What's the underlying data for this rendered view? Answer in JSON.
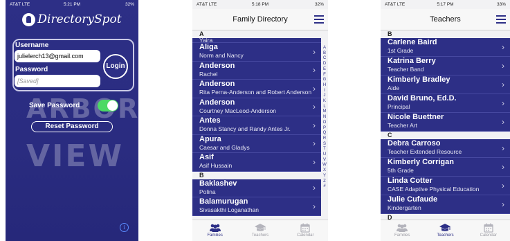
{
  "colors": {
    "brand": "#2d2f86",
    "toggle_on": "#4cd964",
    "info": "#5a8cff"
  },
  "login_screen": {
    "status": {
      "carrier": "AT&T LTE",
      "time": "5:21 PM",
      "battery": "32%"
    },
    "app_name": "DirectorySpot",
    "username_label": "Username",
    "username_value": "julielerch13@gmail.com",
    "password_label": "Password",
    "password_placeholder": "[Saved]",
    "login_button": "Login",
    "save_password_label": "Save Password",
    "reset_password_button": "Reset Password",
    "watermark_top": "ARBOR",
    "watermark_bottom": "VIEW"
  },
  "family_directory": {
    "status": {
      "carrier": "AT&T LTE",
      "time": "5:18 PM",
      "battery": "32%"
    },
    "title": "Family Directory",
    "sections": [
      {
        "letter": "A",
        "rows": [
          {
            "name": "Aliga",
            "sub": "Norm and Nancy"
          },
          {
            "name": "Anderson",
            "sub": "Rachel"
          },
          {
            "name": "Anderson",
            "sub": "Rita Perna-Anderson and Robert Anderson"
          },
          {
            "name": "Anderson",
            "sub": "Courtney MacLeod-Anderson"
          },
          {
            "name": "Antes",
            "sub": "Donna Stancy and Randy Antes Jr."
          },
          {
            "name": "Apura",
            "sub": "Caesar and Gladys"
          },
          {
            "name": "Asif",
            "sub": "Asif Hussain"
          }
        ]
      },
      {
        "letter": "B",
        "rows": [
          {
            "name": "Baklashev",
            "sub": "Polina"
          },
          {
            "name": "Balamurugan",
            "sub": "Sivasakthi Loganathan"
          }
        ]
      }
    ],
    "partial_top_text": "Yaira",
    "index_letters": [
      "A",
      "B",
      "C",
      "D",
      "E",
      "F",
      "G",
      "H",
      "I",
      "J",
      "K",
      "L",
      "M",
      "N",
      "O",
      "P",
      "Q",
      "R",
      "S",
      "T",
      "U",
      "V",
      "W",
      "X",
      "Y",
      "Z",
      "#"
    ],
    "tabs": [
      {
        "label": "Families",
        "icon": "people-icon",
        "active": true
      },
      {
        "label": "Teachers",
        "icon": "graduation-cap-icon",
        "active": false
      },
      {
        "label": "Calendar",
        "icon": "calendar-icon",
        "active": false
      }
    ]
  },
  "teachers": {
    "status": {
      "carrier": "AT&T LTE",
      "time": "5:17 PM",
      "battery": "33%"
    },
    "title": "Teachers",
    "sections": [
      {
        "letter": "B",
        "rows": [
          {
            "name": "Carlene Baird",
            "sub": "1st Grade"
          },
          {
            "name": "Katrina Berry",
            "sub": "Teacher Band"
          },
          {
            "name": "Kimberly Bradley",
            "sub": "Aide"
          },
          {
            "name": "David Bruno, Ed.D.",
            "sub": "Principal"
          },
          {
            "name": "Nicole Buettner",
            "sub": "Teacher Art"
          }
        ]
      },
      {
        "letter": "C",
        "rows": [
          {
            "name": "Debra Carroso",
            "sub": "Teacher Extended Resource"
          },
          {
            "name": "Kimberly Corrigan",
            "sub": "5th Grade"
          },
          {
            "name": "Linda Cotter",
            "sub": "CASE Adaptive Physical Education"
          },
          {
            "name": "Julie Cufaude",
            "sub": "Kindergarten"
          }
        ]
      },
      {
        "letter": "D",
        "rows": []
      }
    ],
    "tabs": [
      {
        "label": "Families",
        "icon": "people-icon",
        "active": false
      },
      {
        "label": "Teachers",
        "icon": "graduation-cap-icon",
        "active": true
      },
      {
        "label": "Calendar",
        "icon": "calendar-icon",
        "active": false
      }
    ]
  }
}
